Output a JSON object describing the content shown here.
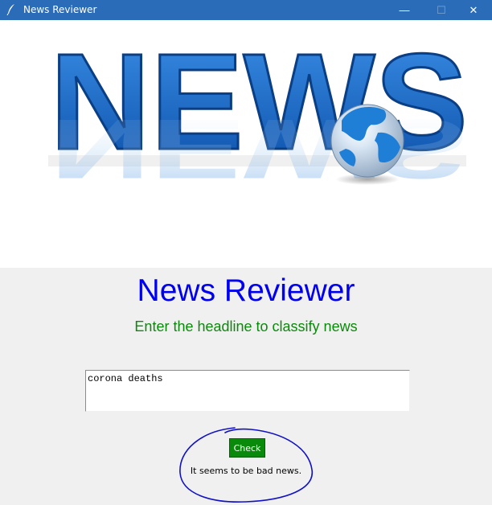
{
  "window": {
    "title": "News Reviewer",
    "app_icon": "feather-icon",
    "controls": {
      "minimize": "—",
      "maximize": "☐",
      "close": "✕"
    }
  },
  "banner": {
    "logo_text": "NEWS",
    "colors": {
      "letters": "#1a73d4",
      "globe_ocean": "#1f7fd6",
      "globe_land": "#e8f0f8"
    }
  },
  "main": {
    "title": "News Reviewer",
    "subtitle": "Enter the headline to classify news",
    "headline_input": {
      "value": "corona deaths",
      "placeholder": ""
    },
    "check_label": "Check",
    "result": "It seems to be bad news."
  },
  "colors": {
    "titlebar": "#2b6cb8",
    "title_text": "#0000f0",
    "subtitle_text": "#0a8a0a",
    "check_button": "#0a8a0a",
    "annotation_circle": "#1010c8"
  }
}
